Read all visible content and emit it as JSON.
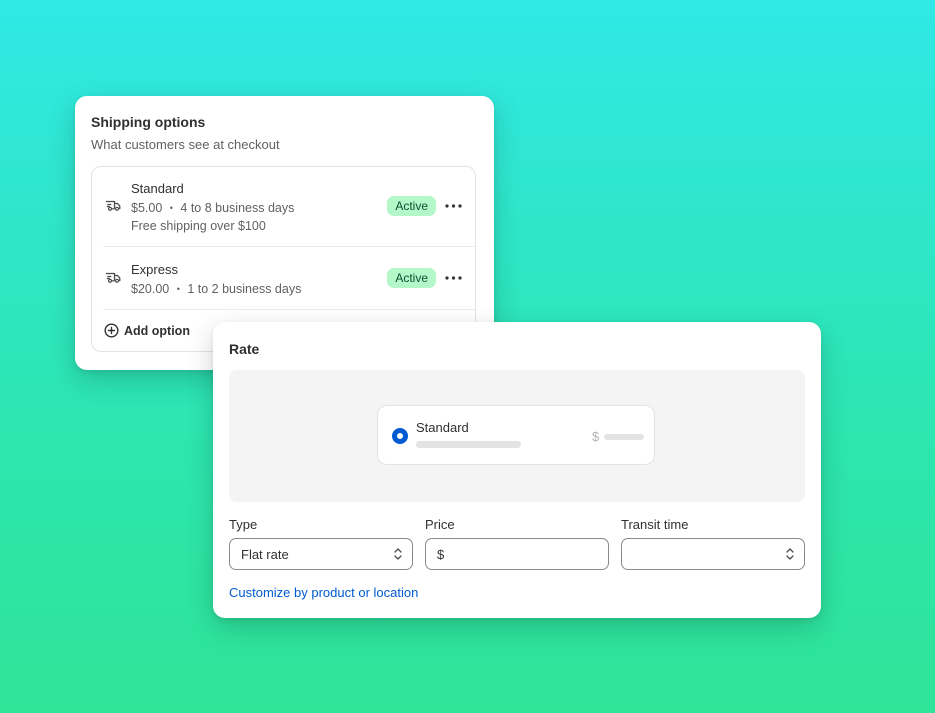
{
  "shipping_options": {
    "title": "Shipping options",
    "subtitle": "What customers see at checkout",
    "options": [
      {
        "name": "Standard",
        "price": "$5.00",
        "time": "4 to 8 business days",
        "note": "Free shipping over $100",
        "status": "Active"
      },
      {
        "name": "Express",
        "price": "$20.00",
        "time": "1 to 2 business days",
        "status": "Active"
      }
    ],
    "detail_separator": "•",
    "add_option_label": "Add option"
  },
  "rate": {
    "title": "Rate",
    "preview": {
      "option_name": "Standard",
      "currency_symbol": "$",
      "selected": true
    },
    "fields": {
      "type": {
        "label": "Type",
        "value": "Flat rate"
      },
      "price": {
        "label": "Price",
        "value": "$"
      },
      "transit_time": {
        "label": "Transit time",
        "value": ""
      }
    },
    "customize_link": "Customize by product or location"
  },
  "colors": {
    "badge_bg": "#b4f7c8",
    "badge_text": "#0c5132",
    "link": "#005bd3",
    "radio": "#005bd3",
    "background_top": "#30e8e6",
    "background_bottom": "#2ee497"
  },
  "icons": [
    "truck-icon",
    "more-horizontal-icon",
    "plus-circle-icon",
    "select-chevron-icon"
  ]
}
